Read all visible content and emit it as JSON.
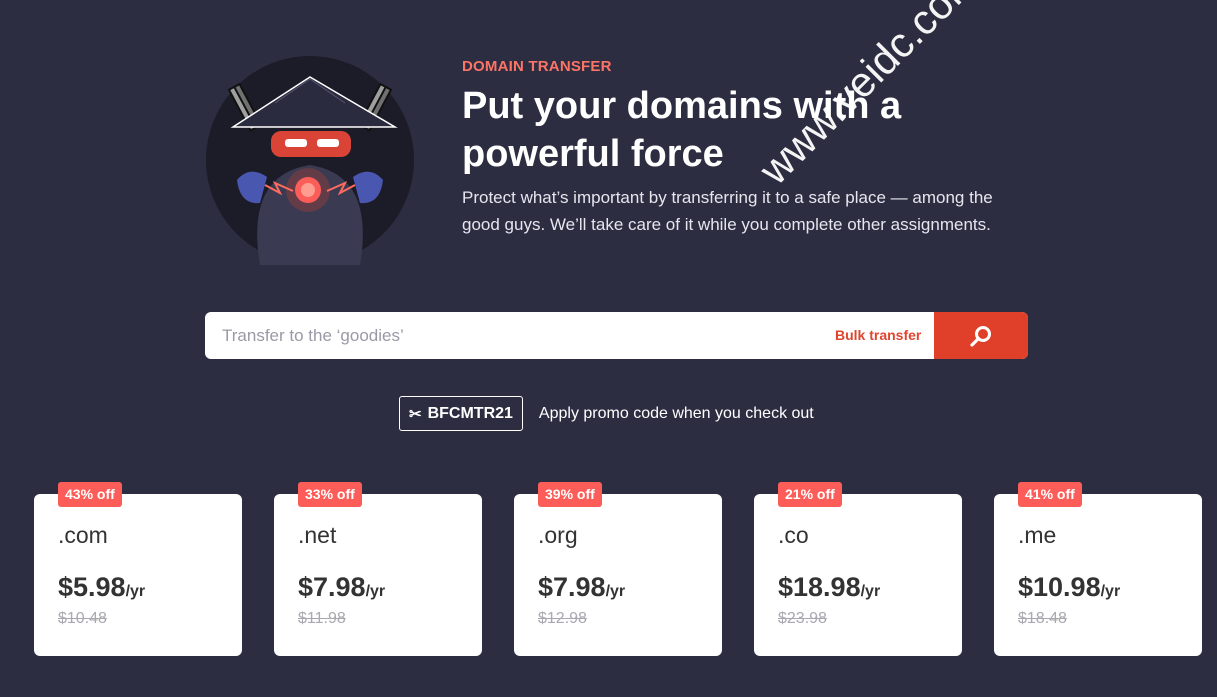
{
  "hero": {
    "eyebrow": "DOMAIN TRANSFER",
    "title": "Put your domains with a powerful force",
    "subtitle": "Protect what’s important by transferring it to a safe place — among the good guys. We’ll take care of it while you complete other assignments."
  },
  "search": {
    "placeholder": "Transfer to the ‘goodies’",
    "bulk_label": "Bulk transfer",
    "button_icon": "search-icon"
  },
  "promo": {
    "code": "BFCMTR21",
    "icon": "scissors-icon",
    "text": "Apply promo code when you check out"
  },
  "cards": [
    {
      "badge": "43% off",
      "tld": ".com",
      "price": "$5.98",
      "per": "/yr",
      "old_price": "$10.48"
    },
    {
      "badge": "33% off",
      "tld": ".net",
      "price": "$7.98",
      "per": "/yr",
      "old_price": "$11.98"
    },
    {
      "badge": "39% off",
      "tld": ".org",
      "price": "$7.98",
      "per": "/yr",
      "old_price": "$12.98"
    },
    {
      "badge": "21% off",
      "tld": ".co",
      "price": "$18.98",
      "per": "/yr",
      "old_price": "$23.98"
    },
    {
      "badge": "41% off",
      "tld": ".me",
      "price": "$10.98",
      "per": "/yr",
      "old_price": "$18.48"
    }
  ],
  "watermark": "www.veidc.com",
  "colors": {
    "background": "#2c2d41",
    "accent": "#e0402a",
    "badge": "#fd5d58",
    "eyebrow": "#fd7466"
  }
}
